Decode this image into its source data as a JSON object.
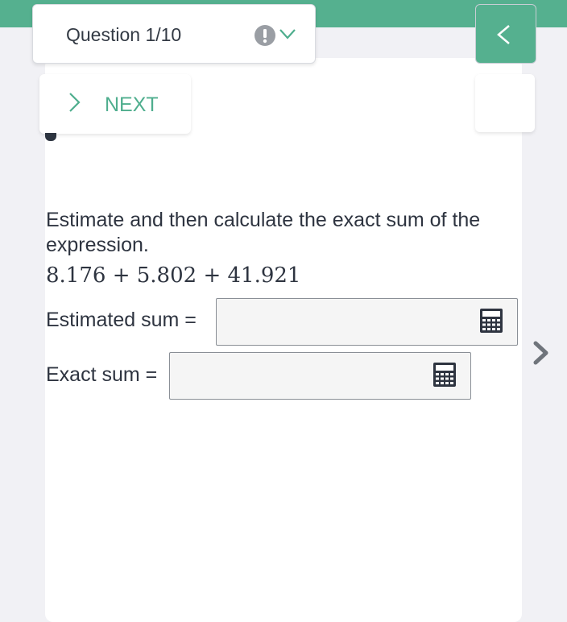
{
  "header": {
    "question_label": "Question 1/10",
    "alert_icon": "exclamation-circle-icon",
    "toggle_icon": "chevron-down-icon",
    "back_icon": "chevron-left-icon",
    "bar_color": "#55b08f"
  },
  "nav": {
    "next_label": "NEXT",
    "next_icon": "chevron-right-icon",
    "forward_icon": "chevron-right-bold-icon"
  },
  "problem": {
    "prompt": "Estimate and then calculate the exact sum of the expression.",
    "expression": "8.176 + 5.802 + 41.921"
  },
  "fields": {
    "estimated_label": "Estimated sum =",
    "estimated_value": "",
    "exact_label": "Exact sum =",
    "exact_value": "",
    "calculator_icon": "calculator-icon"
  }
}
